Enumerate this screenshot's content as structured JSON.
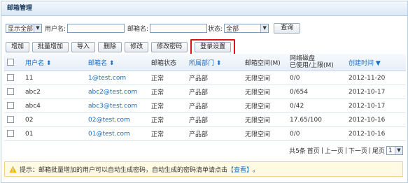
{
  "title": "邮箱管理",
  "filter": {
    "display_select": "显示全部",
    "username_label": "用户名:",
    "mailbox_label": "邮箱名:",
    "status_label": "状态:",
    "status_select": "全部",
    "query_button": "查询"
  },
  "toolbar": {
    "add": "增加",
    "batch_add": "批量增加",
    "import": "导入",
    "delete": "删除",
    "edit": "修改",
    "change_password": "修改密码",
    "login_settings": "登录设置"
  },
  "table": {
    "headers": {
      "username": "用户名",
      "mailbox": "邮箱名",
      "status": "邮箱状态",
      "dept": "所属部门",
      "space": "邮箱空间(M)",
      "disk_line1": "网络磁盘",
      "disk_line2": "已使用/上限(M)",
      "created": "创建时间"
    },
    "rows": [
      {
        "username": "11",
        "mailbox": "1@test.com",
        "status": "正常",
        "dept": "产品部",
        "space": "无限空间",
        "disk": "0/0",
        "created": "2012-11-20"
      },
      {
        "username": "abc2",
        "mailbox": "abc2@test.com",
        "status": "正常",
        "dept": "产品部",
        "space": "无限空间",
        "disk": "0/654",
        "created": "2012-10-17"
      },
      {
        "username": "abc4",
        "mailbox": "abc3@test.com",
        "status": "正常",
        "dept": "产品部",
        "space": "无限空间",
        "disk": "0/42",
        "created": "2012-10-17"
      },
      {
        "username": "02",
        "mailbox": "02@test.com",
        "status": "正常",
        "dept": "产品部",
        "space": "无限空间",
        "disk": "17.65/100",
        "created": "2012-10-16"
      },
      {
        "username": "01",
        "mailbox": "01@test.com",
        "status": "正常",
        "dept": "产品部",
        "space": "无限空间",
        "disk": "0/0",
        "created": "2012-10-16"
      }
    ]
  },
  "pager": {
    "total": "共5条",
    "first": "首页",
    "prev": "上一页",
    "next": "下一页",
    "last": "尾页",
    "page_select": "1"
  },
  "tip": {
    "text": "提示：邮箱批量增加的用户可以自动生成密码，自动生成的密码清单请点击",
    "link": "【查看】",
    "end": "。"
  },
  "colors": {
    "accent": "#1a6fc6",
    "highlight": "#d9141b",
    "tip_bg": "#fffbe3"
  }
}
